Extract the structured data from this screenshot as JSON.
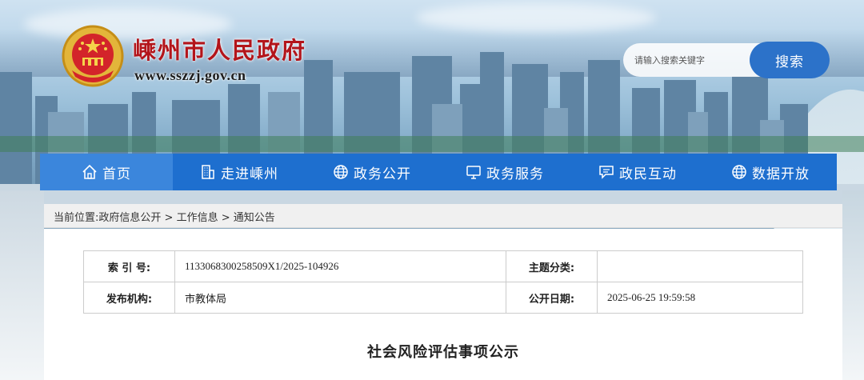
{
  "header": {
    "site_title": "嵊州市人民政府",
    "site_url": "www.sszzj.gov.cn"
  },
  "search": {
    "placeholder": "请输入搜索关键字",
    "button_label": "搜索"
  },
  "nav": {
    "items": [
      {
        "label": "首页",
        "icon": "home-icon"
      },
      {
        "label": "走进嵊州",
        "icon": "building-icon"
      },
      {
        "label": "政务公开",
        "icon": "globe-icon"
      },
      {
        "label": "政务服务",
        "icon": "monitor-icon"
      },
      {
        "label": "政民互动",
        "icon": "chat-icon"
      },
      {
        "label": "数据开放",
        "icon": "globe-icon"
      }
    ]
  },
  "breadcrumb": {
    "prefix": "当前位置:",
    "items": [
      "政府信息公开",
      "工作信息",
      "通知公告"
    ],
    "separator": " > "
  },
  "meta": {
    "index_label": "索 引 号:",
    "index_value": "1133068300258509X1/2025-104926",
    "topic_label": "主题分类:",
    "topic_value": "",
    "org_label": "发布机构:",
    "org_value": "市教体局",
    "date_label": "公开日期:",
    "date_value": "2025-06-25 19:59:58"
  },
  "document": {
    "title": "社会风险评估事项公示"
  },
  "colors": {
    "nav_bg": "#1e6fcf",
    "nav_active": "#3b86dc",
    "title_red": "#b3151b",
    "search_button": "#2c72c9"
  }
}
